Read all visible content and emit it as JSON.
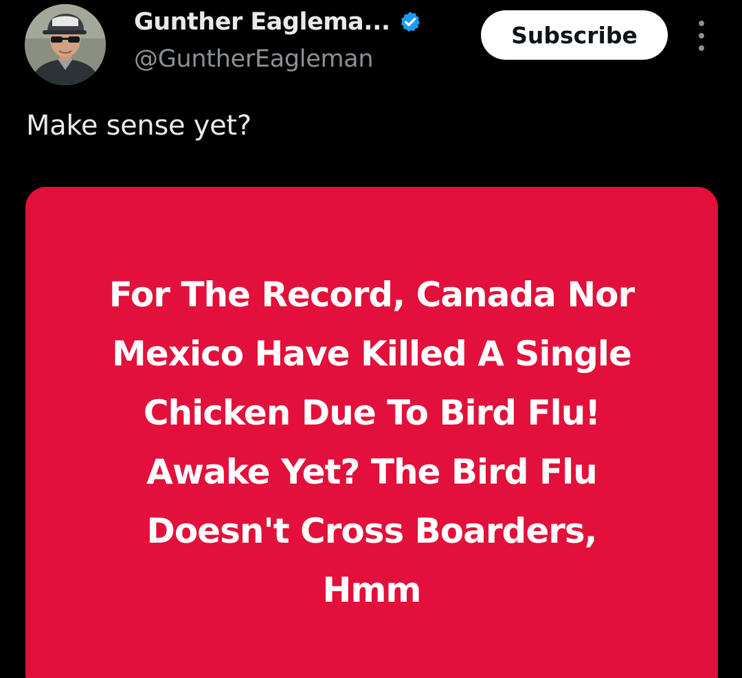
{
  "author": {
    "display_name": "Gunther Eaglema...",
    "handle": "@GuntherEagleman",
    "verified": true,
    "avatar_icon": "profile-photo-man-with-cap-and-sunglasses"
  },
  "actions": {
    "subscribe_label": "Subscribe",
    "more_icon": "vertical-ellipsis-icon"
  },
  "post": {
    "text": "Make sense yet?"
  },
  "media": {
    "background_color": "#e2103a",
    "text_color": "#ffffff",
    "lines": [
      "For The Record, Canada Nor",
      "Mexico Have Killed A Single",
      "Chicken Due To Bird Flu!",
      "Awake Yet? The Bird Flu",
      "Doesn't Cross Boarders,",
      "Hmm"
    ]
  },
  "colors": {
    "background": "#000000",
    "verified_badge": "#1d9bf0",
    "secondary_text": "#8b9196",
    "primary_text": "#e7e9ea"
  }
}
